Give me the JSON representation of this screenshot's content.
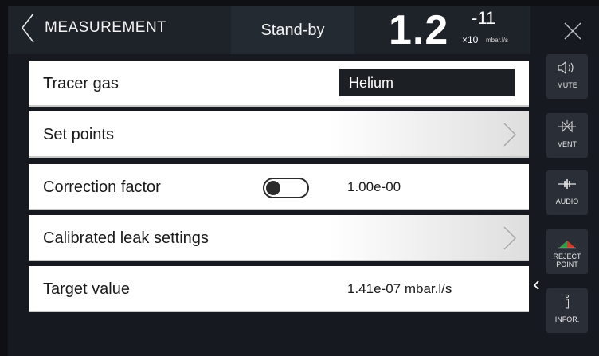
{
  "header": {
    "back_label": "MEASUREMENT",
    "status": "Stand-by",
    "reading": {
      "mantissa": "1.2",
      "exponent": "-11",
      "base": "×10",
      "units": "mbar.l/s"
    }
  },
  "rows": [
    {
      "label": "Tracer gas",
      "value": "Helium"
    },
    {
      "label": "Set points"
    },
    {
      "label": "Correction factor",
      "value": "1.00e-00",
      "toggle_on": false
    },
    {
      "label": "Calibrated leak settings"
    },
    {
      "label": "Target value",
      "value": "1.41e-07 mbar.l/s"
    }
  ],
  "sidebar": {
    "mute": "MUTE",
    "vent": "VENT",
    "audio": "AUDIO",
    "reject_line1": "REJECT",
    "reject_line2": "POINT",
    "info": "INFOR."
  },
  "colors": {
    "background": "#16191f",
    "header": "#1e2229",
    "row": "#ffffff",
    "button": "#2a2f37",
    "reject_green": "#2e9c47",
    "reject_red": "#d23a2e"
  },
  "icons": [
    "chevron-left-icon",
    "close-icon",
    "chevron-right-icon",
    "speaker-mute-icon",
    "vent-valve-icon",
    "audio-wave-icon",
    "reject-point-icon",
    "info-icon"
  ]
}
